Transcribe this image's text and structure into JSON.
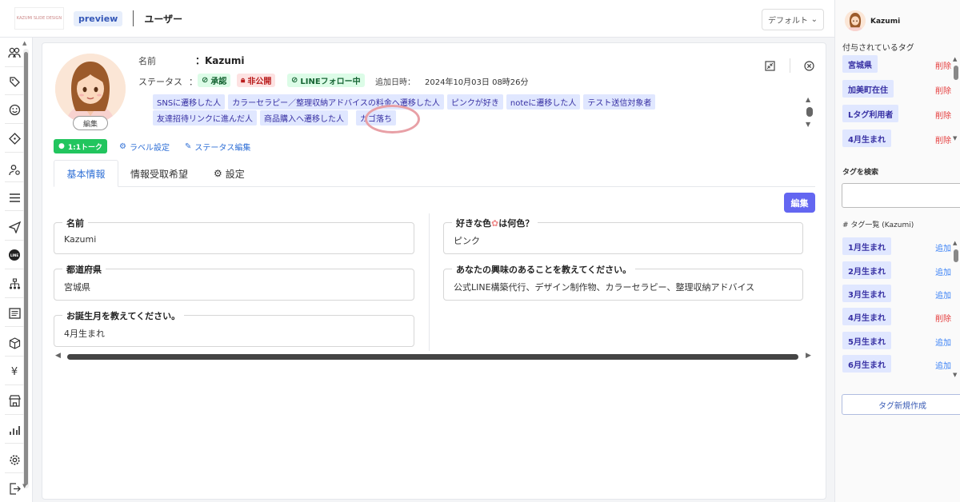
{
  "topbar": {
    "logo_text": "KAZUMI SLIDE DESIGN",
    "preview_label": "preview",
    "page_title": "ユーザー",
    "view_select": "デフォルト"
  },
  "profile": {
    "avatar_edit": "編集",
    "name_label": "名前",
    "name_value": "：Kazumi",
    "status_label": "ステータス",
    "status_sep": "：",
    "status_badges": [
      "承認",
      "非公開",
      "LINEフォロー中"
    ],
    "added_label": "追加日時：",
    "added_value": "2024年10月03日 08時26分",
    "tags_row1": [
      "SNSに遷移した人",
      "カラーセラピー／整理収納アドバイスの料金へ遷移した人",
      "ピンクが好き",
      "noteに遷移した人",
      "テスト送信対象者"
    ],
    "tags_row2": [
      "友達招待リンクに進んだ人",
      "商品購入へ遷移した人",
      "カゴ落ち"
    ]
  },
  "actions": {
    "talk": "1:1トーク",
    "label_settings": "ラベル設定",
    "status_edit": "ステータス編集"
  },
  "tabs": {
    "basic": "基本情報",
    "receive": "情報受取希望",
    "settings": "設定"
  },
  "edit_button": "編集",
  "fields": {
    "name": {
      "label": "名前",
      "value": "Kazumi"
    },
    "prefecture": {
      "label": "都道府県",
      "value": "宮城県"
    },
    "birth_month": {
      "label": "お誕生月を教えてください。",
      "value": "4月生まれ"
    },
    "fav_color": {
      "label_pre": "好きな色",
      "label_post": "は何色？",
      "value": "ピンク"
    },
    "interest": {
      "label": "あなたの興味のあることを教えてください。",
      "value": "公式LINE構築代行、デザイン制作物、カラーセラピー、整理収納アドバイス"
    }
  },
  "right_panel": {
    "user_name": "Kazumi",
    "assigned_heading": "付与されているタグ",
    "assigned_tags": [
      {
        "name": "宮城県",
        "action": "削除"
      },
      {
        "name": "加美町在住",
        "action": "削除"
      },
      {
        "name": "Lタグ利用者",
        "action": "削除"
      },
      {
        "name": "4月生まれ",
        "action": "削除"
      }
    ],
    "search_heading": "タグを検索",
    "list_heading": "# タグ一覧 (Kazumi)",
    "tag_list": [
      {
        "name": "1月生まれ",
        "action": "追加"
      },
      {
        "name": "2月生まれ",
        "action": "追加"
      },
      {
        "name": "3月生まれ",
        "action": "追加"
      },
      {
        "name": "4月生まれ",
        "action": "削除"
      },
      {
        "name": "5月生まれ",
        "action": "追加"
      },
      {
        "name": "6月生まれ",
        "action": "追加"
      }
    ],
    "new_tag_button": "タグ新規作成"
  },
  "colors": {
    "accent": "#6366f1",
    "line_green": "#22c55e",
    "delete_red": "#e53e3e",
    "add_blue": "#3b82f6",
    "tag_bg": "#e0e7ff",
    "highlight": "#e8a0a6"
  },
  "icons": [
    "friends-icon",
    "tag-icon",
    "smile-icon",
    "ticket-icon",
    "user-settings-icon",
    "list-icon",
    "send-icon",
    "line-icon",
    "sitemap-icon",
    "form-icon",
    "box-icon",
    "yen-icon",
    "shop-icon",
    "bar-chart-icon",
    "gear-icon",
    "logout-icon"
  ]
}
